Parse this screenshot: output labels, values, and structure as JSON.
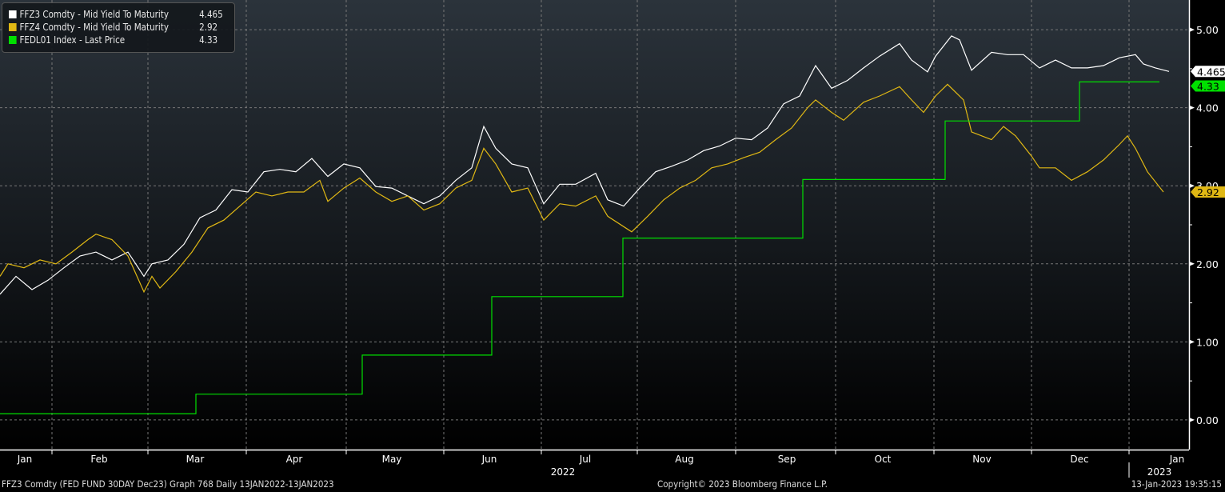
{
  "chart_data": {
    "type": "line",
    "x_unit": "days since 13-Jan-2022",
    "xlim": [
      0,
      371.75
    ],
    "ylim": [
      -0.38,
      5.38
    ],
    "y_ticks": [
      "0.00",
      "1.00",
      "2.00",
      "3.00",
      "4.00",
      "5.00"
    ],
    "y_tick_values": [
      0,
      1,
      2,
      3,
      4,
      5
    ],
    "grid": true,
    "legend_position": "top-left",
    "months": [
      {
        "label": "Jan",
        "center": 0
      },
      {
        "label": "Feb",
        "center": 31
      },
      {
        "label": "Mar",
        "center": 61
      },
      {
        "label": "Apr",
        "center": 92
      },
      {
        "label": "May",
        "center": 122.5
      },
      {
        "label": "Jun",
        "center": 153
      },
      {
        "label": "Jul",
        "center": 183
      },
      {
        "label": "Aug",
        "center": 214
      },
      {
        "label": "Sep",
        "center": 246
      },
      {
        "label": "Oct",
        "center": 276
      },
      {
        "label": "Nov",
        "center": 307
      },
      {
        "label": "Dec",
        "center": 337.5
      },
      {
        "label": "Jan",
        "center": 368
      }
    ],
    "month_gridlines": [
      16.25,
      46.25,
      77,
      108.25,
      138.75,
      169.25,
      199.25,
      230,
      261.25,
      292,
      322.5,
      353
    ],
    "years": [
      {
        "label": "2022",
        "center": 176
      },
      {
        "label": "2023",
        "center": 362.5
      }
    ],
    "year_divider": 353,
    "series": [
      {
        "name": "FFZ3 Comdty - Mid Yield To Maturity",
        "last": "4.465",
        "color": "#ffffff",
        "points": [
          [
            0,
            1.61
          ],
          [
            5,
            1.84
          ],
          [
            10,
            1.67
          ],
          [
            15,
            1.79
          ],
          [
            20,
            1.95
          ],
          [
            25,
            2.1
          ],
          [
            30,
            2.15
          ],
          [
            35,
            2.05
          ],
          [
            40,
            2.15
          ],
          [
            45,
            1.84
          ],
          [
            47.5,
            2.0
          ],
          [
            52.5,
            2.05
          ],
          [
            57.5,
            2.25
          ],
          [
            62.5,
            2.59
          ],
          [
            67.5,
            2.69
          ],
          [
            72.5,
            2.95
          ],
          [
            77.5,
            2.92
          ],
          [
            82.5,
            3.18
          ],
          [
            87.5,
            3.21
          ],
          [
            92.5,
            3.18
          ],
          [
            97.5,
            3.35
          ],
          [
            102.5,
            3.12
          ],
          [
            107.5,
            3.28
          ],
          [
            112.5,
            3.23
          ],
          [
            117.5,
            2.99
          ],
          [
            122.5,
            2.97
          ],
          [
            127.5,
            2.87
          ],
          [
            132.5,
            2.77
          ],
          [
            137.5,
            2.87
          ],
          [
            142.5,
            3.07
          ],
          [
            147.5,
            3.23
          ],
          [
            151.25,
            3.76
          ],
          [
            155,
            3.48
          ],
          [
            160,
            3.28
          ],
          [
            165,
            3.23
          ],
          [
            170,
            2.77
          ],
          [
            175,
            3.02
          ],
          [
            180,
            3.02
          ],
          [
            186.25,
            3.16
          ],
          [
            190,
            2.82
          ],
          [
            195,
            2.74
          ],
          [
            200,
            2.97
          ],
          [
            205,
            3.18
          ],
          [
            210,
            3.25
          ],
          [
            215,
            3.33
          ],
          [
            220,
            3.45
          ],
          [
            225,
            3.51
          ],
          [
            230,
            3.61
          ],
          [
            235,
            3.59
          ],
          [
            240,
            3.74
          ],
          [
            245,
            4.05
          ],
          [
            250,
            4.15
          ],
          [
            255,
            4.54
          ],
          [
            260,
            4.25
          ],
          [
            265,
            4.35
          ],
          [
            270,
            4.51
          ],
          [
            275,
            4.66
          ],
          [
            281.25,
            4.82
          ],
          [
            285,
            4.61
          ],
          [
            290,
            4.46
          ],
          [
            292.5,
            4.66
          ],
          [
            297.5,
            4.92
          ],
          [
            300,
            4.87
          ],
          [
            303.75,
            4.48
          ],
          [
            310,
            4.71
          ],
          [
            315,
            4.68
          ],
          [
            320,
            4.68
          ],
          [
            325,
            4.51
          ],
          [
            330,
            4.61
          ],
          [
            335,
            4.51
          ],
          [
            340,
            4.51
          ],
          [
            345,
            4.54
          ],
          [
            350,
            4.64
          ],
          [
            355,
            4.68
          ],
          [
            357.5,
            4.56
          ],
          [
            361.25,
            4.51
          ],
          [
            365.5,
            4.465
          ]
        ]
      },
      {
        "name": "FFZ4 Comdty - Mid Yield To Maturity",
        "last": "2.92",
        "color": "#e0b814",
        "points": [
          [
            0,
            1.84
          ],
          [
            2.5,
            2.0
          ],
          [
            7.5,
            1.95
          ],
          [
            12.5,
            2.05
          ],
          [
            17.5,
            2.0
          ],
          [
            22.5,
            2.15
          ],
          [
            27.5,
            2.31
          ],
          [
            30,
            2.38
          ],
          [
            35,
            2.31
          ],
          [
            40,
            2.1
          ],
          [
            45,
            1.64
          ],
          [
            47.5,
            1.84
          ],
          [
            50,
            1.69
          ],
          [
            55,
            1.9
          ],
          [
            60,
            2.15
          ],
          [
            65,
            2.46
          ],
          [
            70,
            2.56
          ],
          [
            75,
            2.74
          ],
          [
            80,
            2.92
          ],
          [
            85,
            2.87
          ],
          [
            90,
            2.92
          ],
          [
            95,
            2.92
          ],
          [
            100,
            3.07
          ],
          [
            102.5,
            2.8
          ],
          [
            107.5,
            2.97
          ],
          [
            112.5,
            3.1
          ],
          [
            117.5,
            2.92
          ],
          [
            122.5,
            2.8
          ],
          [
            127.5,
            2.87
          ],
          [
            132.5,
            2.69
          ],
          [
            137.5,
            2.77
          ],
          [
            142.5,
            2.97
          ],
          [
            147.5,
            3.07
          ],
          [
            151.25,
            3.48
          ],
          [
            155,
            3.28
          ],
          [
            160,
            2.92
          ],
          [
            165,
            2.97
          ],
          [
            170,
            2.56
          ],
          [
            175,
            2.77
          ],
          [
            180,
            2.74
          ],
          [
            186.25,
            2.87
          ],
          [
            190,
            2.61
          ],
          [
            197.5,
            2.41
          ],
          [
            202.5,
            2.61
          ],
          [
            207.5,
            2.82
          ],
          [
            212.5,
            2.97
          ],
          [
            217.5,
            3.07
          ],
          [
            222.5,
            3.23
          ],
          [
            227.5,
            3.28
          ],
          [
            232.5,
            3.36
          ],
          [
            237.5,
            3.43
          ],
          [
            242.5,
            3.59
          ],
          [
            247.5,
            3.74
          ],
          [
            252.5,
            4.0
          ],
          [
            255,
            4.1
          ],
          [
            260,
            3.94
          ],
          [
            263.75,
            3.84
          ],
          [
            270,
            4.07
          ],
          [
            275,
            4.15
          ],
          [
            281.25,
            4.27
          ],
          [
            285,
            4.1
          ],
          [
            288.75,
            3.94
          ],
          [
            292.5,
            4.15
          ],
          [
            296.25,
            4.3
          ],
          [
            301.25,
            4.1
          ],
          [
            303.75,
            3.69
          ],
          [
            310,
            3.59
          ],
          [
            313.75,
            3.76
          ],
          [
            317.5,
            3.64
          ],
          [
            322.5,
            3.38
          ],
          [
            325,
            3.23
          ],
          [
            330,
            3.23
          ],
          [
            335,
            3.07
          ],
          [
            340,
            3.18
          ],
          [
            345,
            3.33
          ],
          [
            350,
            3.53
          ],
          [
            352.5,
            3.64
          ],
          [
            355,
            3.48
          ],
          [
            358.75,
            3.18
          ],
          [
            363.75,
            2.92
          ]
        ]
      },
      {
        "name": "FEDL01 Index - Last Price",
        "last": "4.33",
        "color": "#00e000",
        "step": true,
        "points": [
          [
            0,
            0.08
          ],
          [
            61.25,
            0.08
          ],
          [
            61.25,
            0.33
          ],
          [
            113.25,
            0.33
          ],
          [
            113.25,
            0.83
          ],
          [
            153.75,
            0.83
          ],
          [
            153.75,
            1.58
          ],
          [
            194.75,
            1.58
          ],
          [
            194.75,
            2.33
          ],
          [
            251,
            2.33
          ],
          [
            251,
            3.08
          ],
          [
            295.5,
            3.08
          ],
          [
            295.5,
            3.83
          ],
          [
            337.5,
            3.83
          ],
          [
            337.5,
            4.33
          ],
          [
            362.5,
            4.33
          ]
        ]
      }
    ]
  },
  "legend": [
    {
      "label": "FFZ3 Comdty - Mid Yield To Maturity",
      "value": "4.465"
    },
    {
      "label": "FFZ4 Comdty - Mid Yield To Maturity",
      "value": "2.92"
    },
    {
      "label": "FEDL01 Index - Last Price",
      "value": "4.33"
    }
  ],
  "footer": {
    "left": "FFZ3 Comdty (FED FUND 30DAY    Dec23) Graph 768  Daily 13JAN2022-13JAN2023",
    "center": "Copyright© 2023 Bloomberg Finance L.P.",
    "right": "13-Jan-2023 19:35:15"
  }
}
